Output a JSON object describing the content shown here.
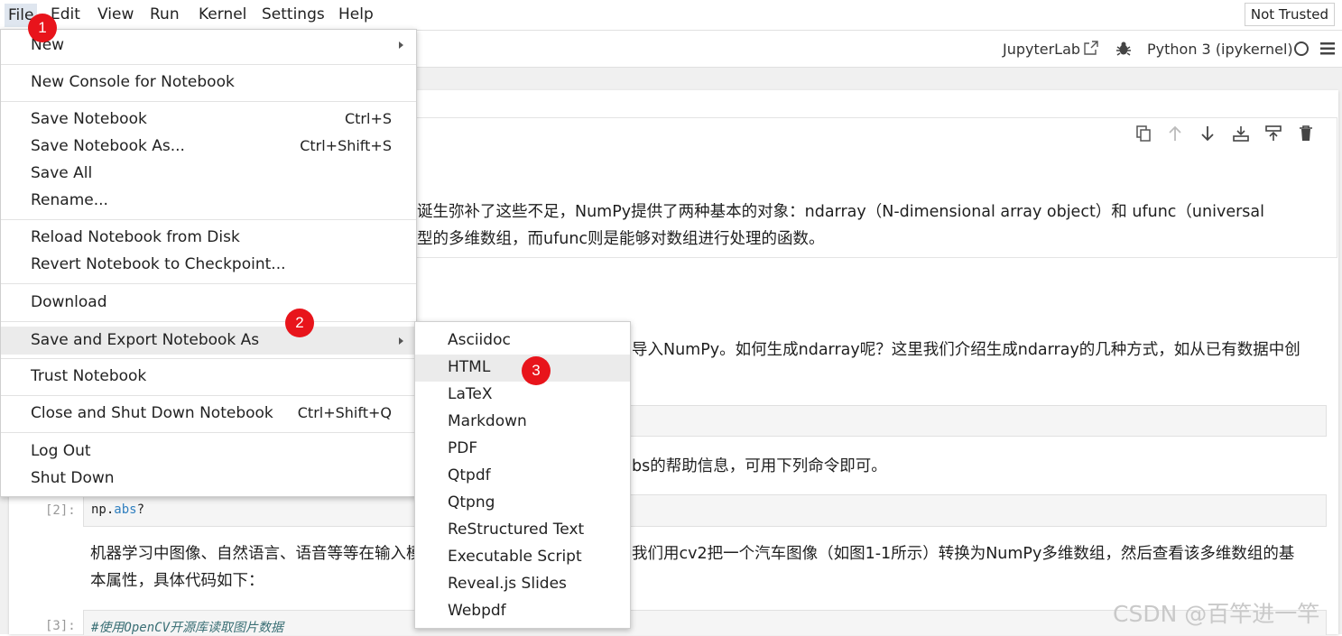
{
  "menubar": {
    "items": [
      "File",
      "Edit",
      "View",
      "Run",
      "Kernel",
      "Settings",
      "Help"
    ],
    "trust_status": "Not Trusted"
  },
  "toolbar": {
    "jupyterlab_label": "JupyterLab",
    "kernel_name": "Python 3 (ipykernel)"
  },
  "notebook": {
    "md_line1": "诞生弥补了这些不足，NumPy提供了两种基本的对象：ndarray（N-dimensional array object）和 ufunc（universal",
    "md_line2": "型的多维数组，而ufunc则是能够对数组进行处理的函数。",
    "md_line3": "导入NumPy。如何生成ndarray呢？这里我们介绍生成ndarray的几种方式，如从已有数据中创",
    "md_line4": "bs的帮助信息，可用下列命令即可。",
    "cell2_prompt": "[2]:",
    "cell2_code_obj": "np.",
    "cell2_code_attr": "abs",
    "cell2_code_tail": "?",
    "md_line5a": "机器学习中图像、自然语言、语音等等在输入模",
    "md_line5b": "我们用cv2把一个汽车图像（如图1-1所示）转换为NumPy多维数组，然后查看该多维数组的基",
    "md_line6": "本属性，具体代码如下：",
    "cell3_prompt": "[3]:",
    "cell3_code": "#使用OpenCV开源库读取图片数据"
  },
  "file_menu": {
    "items": [
      {
        "label": "New",
        "shortcut": "",
        "submenu": true
      },
      {
        "label": "New Console for Notebook",
        "shortcut": ""
      },
      {
        "label": "Save Notebook",
        "shortcut": "Ctrl+S"
      },
      {
        "label": "Save Notebook As...",
        "shortcut": "Ctrl+Shift+S"
      },
      {
        "label": "Save All",
        "shortcut": ""
      },
      {
        "label": "Rename...",
        "shortcut": ""
      },
      {
        "label": "Reload Notebook from Disk",
        "shortcut": ""
      },
      {
        "label": "Revert Notebook to Checkpoint...",
        "shortcut": ""
      },
      {
        "label": "Download",
        "shortcut": ""
      },
      {
        "label": "Save and Export Notebook As",
        "shortcut": "",
        "submenu": true,
        "highlighted": true
      },
      {
        "label": "Trust Notebook",
        "shortcut": ""
      },
      {
        "label": "Close and Shut Down Notebook",
        "shortcut": "Ctrl+Shift+Q"
      },
      {
        "label": "Log Out",
        "shortcut": ""
      },
      {
        "label": "Shut Down",
        "shortcut": ""
      }
    ]
  },
  "export_menu": {
    "items": [
      "Asciidoc",
      "HTML",
      "LaTeX",
      "Markdown",
      "PDF",
      "Qtpdf",
      "Qtpng",
      "ReStructured Text",
      "Executable Script",
      "Reveal.js Slides",
      "Webpdf"
    ],
    "highlighted": "HTML"
  },
  "badges": [
    "1",
    "2",
    "3"
  ],
  "watermark": "CSDN @百竿进一竿",
  "colors": {
    "badge": "#e8141b",
    "menu_highlight": "#ebebeb"
  }
}
